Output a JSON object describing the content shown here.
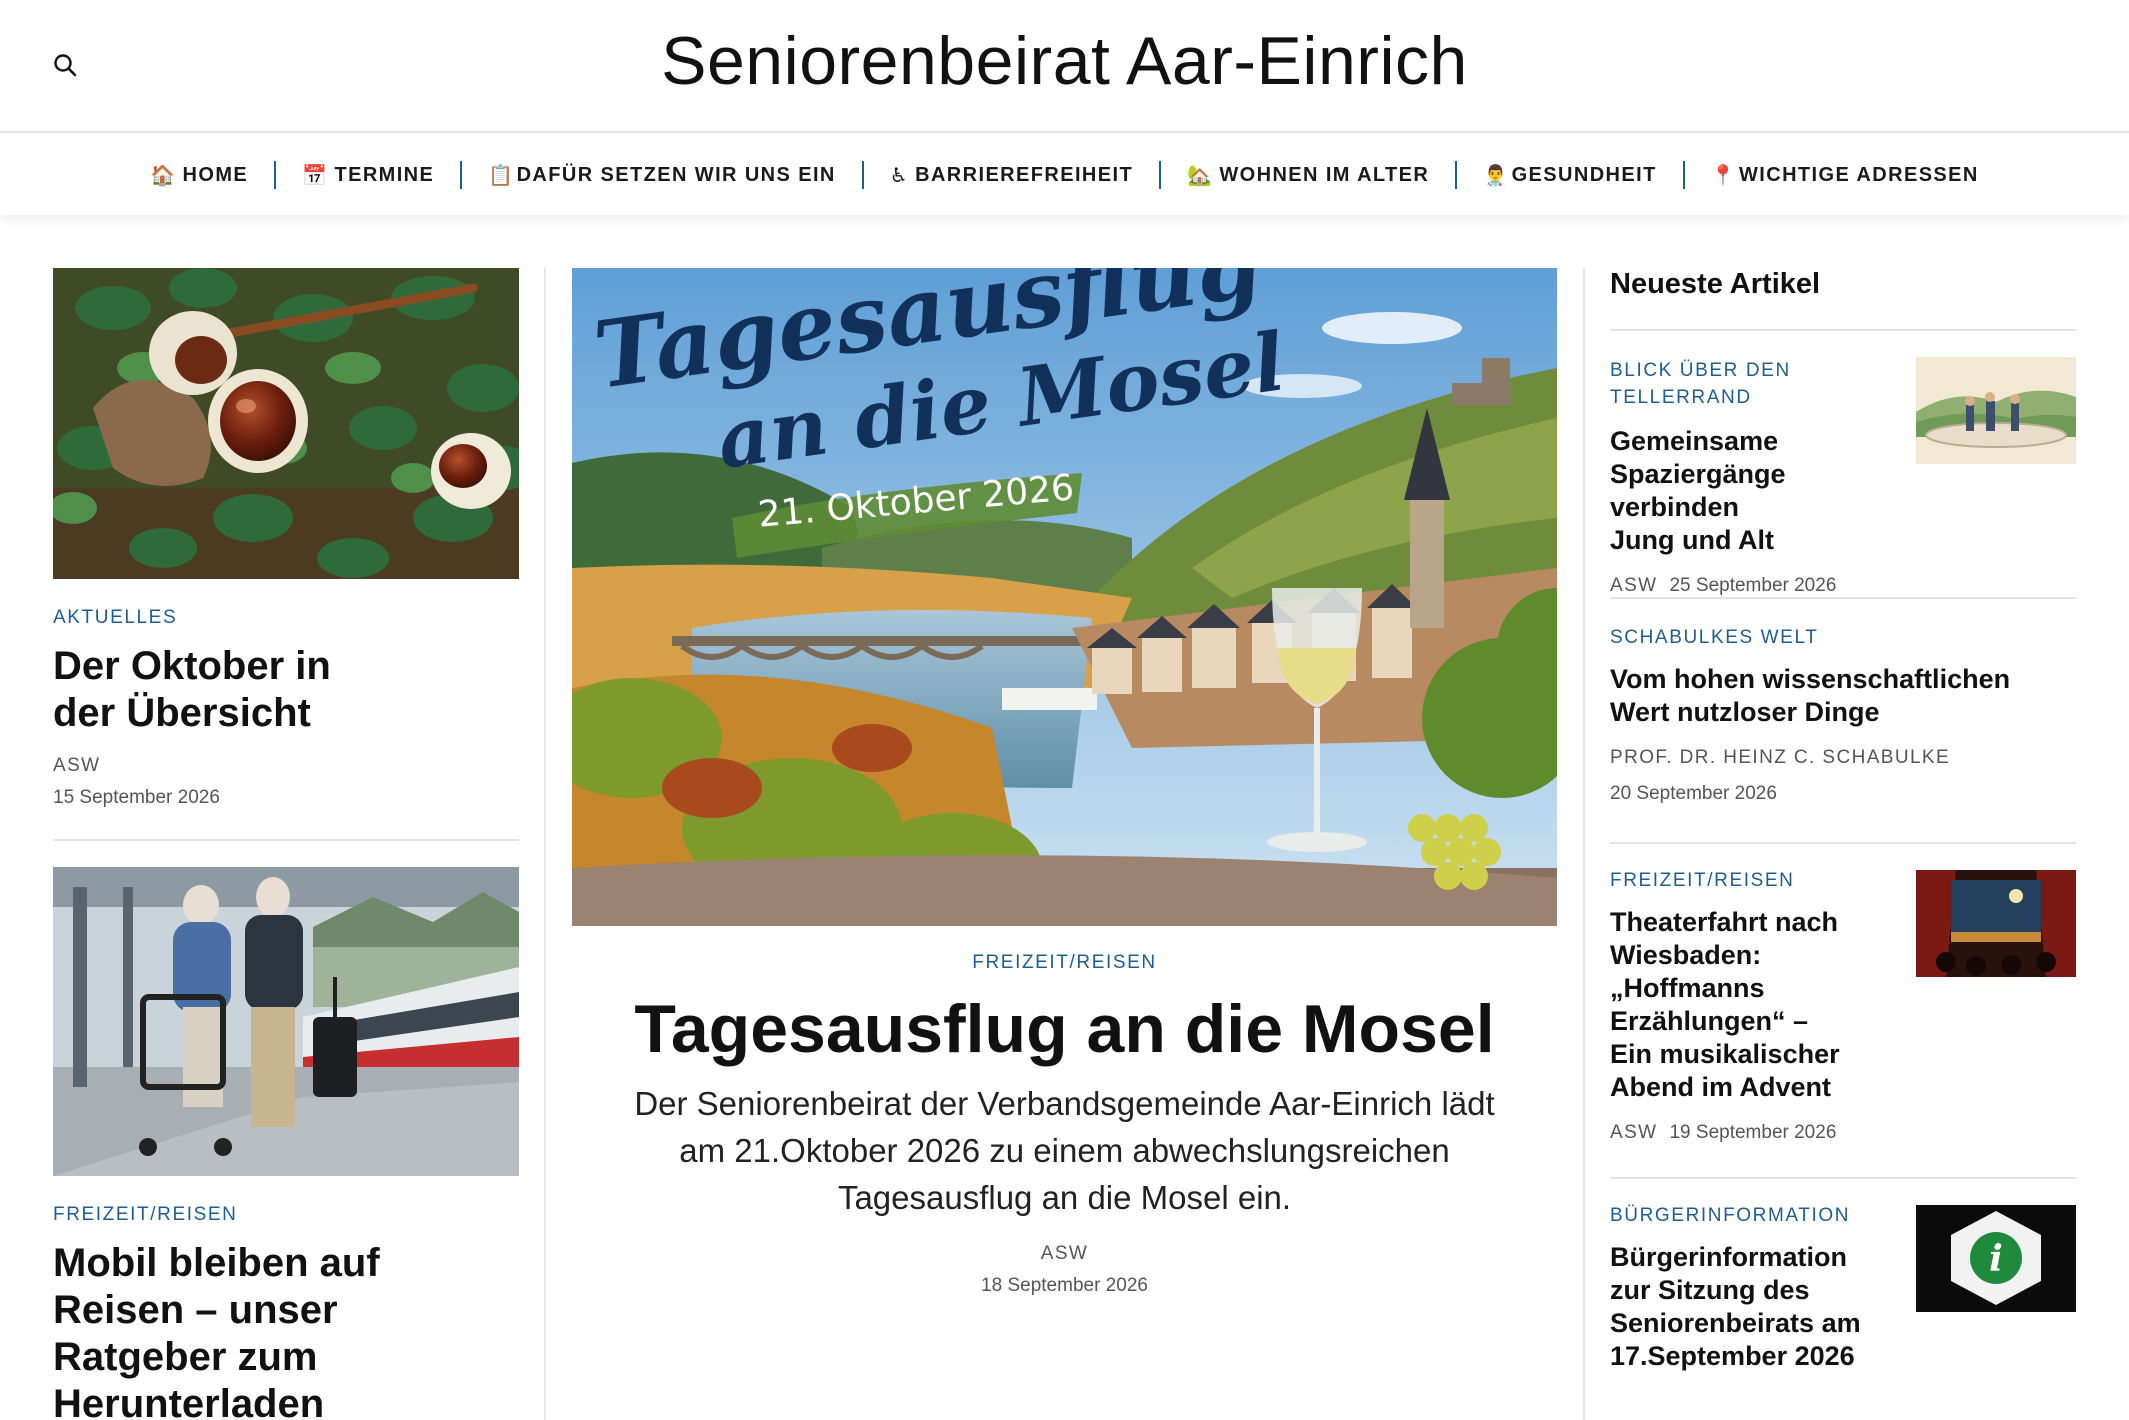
{
  "header": {
    "site_title": "Seniorenbeirat Aar-Einrich",
    "search_icon": "search-icon"
  },
  "nav": {
    "items": [
      {
        "emoji": "🏠",
        "label": "HOME"
      },
      {
        "emoji": "📅",
        "label": "TERMINE"
      },
      {
        "emoji": "📋",
        "label": "DAFÜR SETZEN WIR UNS EIN"
      },
      {
        "emoji": "♿",
        "label": "BARRIEREFREIHEIT"
      },
      {
        "emoji": "🏡",
        "label": "WOHNEN IM ALTER"
      },
      {
        "emoji": "👨‍⚕️",
        "label": "GESUNDHEIT"
      },
      {
        "emoji": "📍",
        "label": "WICHTIGE ADRESSEN"
      }
    ]
  },
  "left_posts": [
    {
      "category": "AKTUELLES",
      "title": "Der Oktober in der Übersicht",
      "author": "ASW",
      "date": "15 September 2026",
      "image": "chestnuts-photo"
    },
    {
      "category": "FREIZEIT/REISEN",
      "title": "Mobil bleiben auf Reisen – unser Ratgeber zum Herunterladen",
      "image": "seniors-train-station-photo"
    }
  ],
  "featured": {
    "image_text": {
      "line1": "Tagesausflug",
      "line2": "an die Mosel",
      "date_banner": "21. Oktober 2026"
    },
    "category": "FREIZEIT/REISEN",
    "title": "Tagesausflug an die Mosel",
    "excerpt": "Der Seniorenbeirat der Verbandsgemeinde Aar-Einrich lädt am 21.Oktober 2026 zu einem abwechslungsreichen Tagesausflug an die Mosel ein.",
    "author": "ASW",
    "date": "18 September 2026"
  },
  "sidebar": {
    "heading": "Neueste Artikel",
    "articles": [
      {
        "category": "BLICK ÜBER DEN TELLERRAND",
        "title": "Gemeinsame Spaziergänge verbinden Jung und Alt",
        "author": "ASW",
        "date": "25 September 2026",
        "image": "illustration-walk-thumb"
      },
      {
        "category": "SCHABULKES WELT",
        "title": "Vom hohen wissenschaftlichen Wert nutzloser Dinge",
        "author": "PROF. DR. HEINZ C. SCHABULKE",
        "date": "20 September 2026"
      },
      {
        "category": "FREIZEIT/REISEN",
        "title": "Theaterfahrt nach Wiesbaden: „Hoffmanns Erzählungen“ – Ein musikalischer Abend im Advent",
        "author": "ASW",
        "date": "19 September 2026",
        "image": "theater-stage-thumb"
      },
      {
        "category": "BÜRGERINFORMATION",
        "title": "Bürgerinformation zur Sitzung des Seniorenbeirats am 17.September 2026",
        "image": "info-sign-thumb"
      }
    ]
  }
}
